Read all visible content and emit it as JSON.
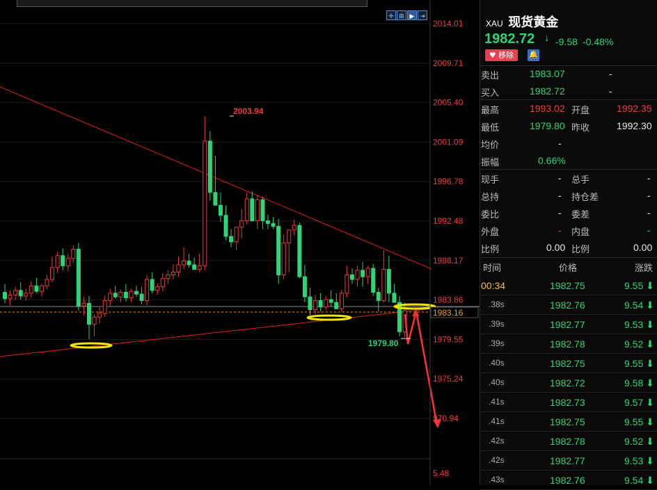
{
  "colors": {
    "up": "#ee3b3b",
    "down": "#2fd477",
    "accent_yellow": "#f2e400",
    "background": "#000000"
  },
  "toolbar": {
    "icons": [
      "crosshair-icon",
      "grid-icon",
      "play-icon",
      "export-icon"
    ]
  },
  "chart_data": {
    "type": "candlestick",
    "y_axis_labels": [
      "2014.01",
      "2009.71",
      "2005.40",
      "2001.09",
      "1996.78",
      "1992.48",
      "1988.17",
      "1983.86",
      "1979.55",
      "1975.24",
      "970.94"
    ],
    "volume_axis_label": "5.48",
    "current_price_label": "1983.16",
    "high_annotation": "2003.94",
    "low_annotation": "1979.80",
    "ylim": [
      1970.94,
      2014.01
    ],
    "candles": [
      [
        1984.7,
        1985.6,
        1983.5,
        1984.0
      ],
      [
        1984.0,
        1984.9,
        1983.3,
        1984.4
      ],
      [
        1984.4,
        1985.3,
        1983.9,
        1984.9
      ],
      [
        1984.9,
        1985.8,
        1983.9,
        1984.3
      ],
      [
        1984.3,
        1985.1,
        1983.8,
        1984.6
      ],
      [
        1984.6,
        1985.9,
        1984.1,
        1985.4
      ],
      [
        1985.4,
        1986.3,
        1984.6,
        1984.8
      ],
      [
        1984.8,
        1985.6,
        1984.2,
        1985.4
      ],
      [
        1985.4,
        1986.6,
        1985.0,
        1986.1
      ],
      [
        1986.1,
        1988.6,
        1985.8,
        1987.4
      ],
      [
        1987.4,
        1989.1,
        1986.8,
        1988.7
      ],
      [
        1988.7,
        1989.5,
        1987.1,
        1987.6
      ],
      [
        1987.6,
        1988.9,
        1987.0,
        1988.4
      ],
      [
        1988.4,
        1989.8,
        1987.9,
        1989.4
      ],
      [
        1989.4,
        1990.1,
        1982.7,
        1983.2
      ],
      [
        1983.2,
        1984.2,
        1982.2,
        1983.5
      ],
      [
        1983.5,
        1984.3,
        1979.6,
        1981.2
      ],
      [
        1981.2,
        1982.3,
        1979.9,
        1982.0
      ],
      [
        1982.0,
        1983.1,
        1981.3,
        1982.4
      ],
      [
        1982.4,
        1984.3,
        1982.0,
        1983.8
      ],
      [
        1983.8,
        1985.1,
        1983.2,
        1984.6
      ],
      [
        1984.6,
        1985.4,
        1984.0,
        1984.2
      ],
      [
        1984.2,
        1985.0,
        1983.6,
        1984.7
      ],
      [
        1984.7,
        1985.6,
        1983.7,
        1984.1
      ],
      [
        1984.1,
        1985.1,
        1983.6,
        1984.8
      ],
      [
        1984.8,
        1985.4,
        1984.2,
        1984.5
      ],
      [
        1984.5,
        1985.3,
        1983.4,
        1983.8
      ],
      [
        1983.8,
        1986.6,
        1983.3,
        1986.1
      ],
      [
        1986.1,
        1986.9,
        1984.6,
        1984.9
      ],
      [
        1984.9,
        1985.7,
        1984.4,
        1985.3
      ],
      [
        1985.3,
        1986.8,
        1984.8,
        1986.2
      ],
      [
        1986.2,
        1987.1,
        1985.6,
        1986.6
      ],
      [
        1986.6,
        1987.8,
        1986.1,
        1986.9
      ],
      [
        1986.9,
        1988.6,
        1986.4,
        1987.7
      ],
      [
        1987.7,
        1989.6,
        1987.2,
        1988.1
      ],
      [
        1988.1,
        1988.9,
        1987.4,
        1987.7
      ],
      [
        1987.7,
        1988.5,
        1987.1,
        1987.2
      ],
      [
        1987.2,
        1988.9,
        1986.9,
        1987.6
      ],
      [
        1987.6,
        2003.9,
        1987.1,
        2001.2
      ],
      [
        2001.2,
        2002.3,
        1994.7,
        1995.6
      ],
      [
        1995.6,
        1999.6,
        1994.2,
        1994.2
      ],
      [
        1994.2,
        1995.6,
        1992.4,
        1993.1
      ],
      [
        1993.1,
        1994.2,
        1990.4,
        1990.8
      ],
      [
        1990.8,
        1991.6,
        1989.6,
        1990.2
      ],
      [
        1990.2,
        1991.1,
        1989.3,
        1991.8
      ],
      [
        1991.8,
        1993.8,
        1990.6,
        1992.5
      ],
      [
        1992.5,
        1995.6,
        1992.1,
        1994.9
      ],
      [
        1994.9,
        1995.7,
        1992.4,
        1992.5
      ],
      [
        1992.5,
        1995.3,
        1991.6,
        1994.8
      ],
      [
        1994.8,
        1995.1,
        1991.6,
        1992.5
      ],
      [
        1992.5,
        1993.2,
        1991.6,
        1992.2
      ],
      [
        1992.2,
        1992.9,
        1991.6,
        1991.9
      ],
      [
        1991.9,
        1992.7,
        1985.6,
        1986.6
      ],
      [
        1986.6,
        1991.0,
        1986.1,
        1990.1
      ],
      [
        1990.1,
        1991.1,
        1986.9,
        1991.5
      ],
      [
        1991.5,
        1992.6,
        1990.9,
        1992.0
      ],
      [
        1992.0,
        1992.3,
        1986.2,
        1986.4
      ],
      [
        1986.4,
        1987.7,
        1983.6,
        1984.2
      ],
      [
        1984.2,
        1985.2,
        1982.2,
        1982.8
      ],
      [
        1982.8,
        1984.4,
        1982.3,
        1983.8
      ],
      [
        1983.8,
        1984.6,
        1982.6,
        1983.1
      ],
      [
        1983.1,
        1984.3,
        1982.7,
        1983.9
      ],
      [
        1983.9,
        1984.9,
        1983.1,
        1983.6
      ],
      [
        1983.6,
        1984.6,
        1982.9,
        1982.9
      ],
      [
        1982.9,
        1984.9,
        1982.6,
        1984.6
      ],
      [
        1984.6,
        1987.6,
        1984.1,
        1986.6
      ],
      [
        1986.6,
        1987.3,
        1985.6,
        1986.1
      ],
      [
        1986.1,
        1987.6,
        1985.3,
        1987.1
      ],
      [
        1987.1,
        1988.0,
        1985.3,
        1986.4
      ],
      [
        1986.4,
        1987.6,
        1985.6,
        1987.3
      ],
      [
        1987.3,
        1987.8,
        1984.3,
        1984.7
      ],
      [
        1984.7,
        1985.2,
        1982.6,
        1983.8
      ],
      [
        1983.8,
        1989.3,
        1983.6,
        1987.2
      ],
      [
        1987.2,
        1988.7,
        1983.6,
        1984.6
      ],
      [
        1984.6,
        1985.6,
        1983.6,
        1983.6
      ],
      [
        1983.6,
        1984.3,
        1979.9,
        1980.4
      ],
      [
        1980.4,
        1983.6,
        1979.8,
        1982.7
      ]
    ]
  },
  "panel": {
    "code": "XAU",
    "name": "现货黄金",
    "price": "1982.72",
    "arrow": "↓",
    "change": "-9.58",
    "change_pct": "-0.48%",
    "remove_label": "移除",
    "bell": "🔔",
    "quote": {
      "sell_label": "卖出",
      "sell_value": "1983.07",
      "sell_extra": "-",
      "buy_label": "买入",
      "buy_value": "1982.72",
      "buy_extra": "-",
      "high_label": "最高",
      "high_value": "1993.02",
      "open_label": "开盘",
      "open_value": "1992.35",
      "low_label": "最低",
      "low_value": "1979.80",
      "prev_label": "昨收",
      "prev_value": "1992.30",
      "avg_label": "均价",
      "avg_value": "-",
      "amp_label": "振幅",
      "amp_value": "0.66%",
      "cur_vol_label": "现手",
      "cur_vol_value": "-",
      "total_vol_label": "总手",
      "total_vol_value": "-",
      "total_oi_label": "总持",
      "total_oi_value": "-",
      "oi_diff_label": "持仓差",
      "oi_diff_value": "-",
      "ratio_label": "委比",
      "ratio_value": "-",
      "diff_label": "委差",
      "diff_value": "-",
      "outer_label": "外盘",
      "outer_value": "-",
      "inner_label": "内盘",
      "inner_value": "-",
      "pct1_label": "比例",
      "pct1_value": "0.00",
      "pct2_label": "比例",
      "pct2_value": "0.00"
    },
    "ticks": {
      "headers": [
        "时间",
        "价格",
        "涨跌"
      ],
      "rows": [
        {
          "time": "00:34",
          "price": "1982.75",
          "change": "9.55",
          "arrow": "⬇"
        },
        {
          "time": ".38s",
          "price": "1982.76",
          "change": "9.54",
          "arrow": "⬇"
        },
        {
          "time": ".39s",
          "price": "1982.77",
          "change": "9.53",
          "arrow": "⬇"
        },
        {
          "time": ".39s",
          "price": "1982.78",
          "change": "9.52",
          "arrow": "⬇"
        },
        {
          "time": ".40s",
          "price": "1982.75",
          "change": "9.55",
          "arrow": "⬇"
        },
        {
          "time": ".40s",
          "price": "1982.72",
          "change": "9.58",
          "arrow": "⬇"
        },
        {
          "time": ".41s",
          "price": "1982.73",
          "change": "9.57",
          "arrow": "⬇"
        },
        {
          "time": ".41s",
          "price": "1982.75",
          "change": "9.55",
          "arrow": "⬇"
        },
        {
          "time": ".42s",
          "price": "1982.78",
          "change": "9.52",
          "arrow": "⬇"
        },
        {
          "time": ".42s",
          "price": "1982.77",
          "change": "9.53",
          "arrow": "⬇"
        },
        {
          "time": ".43s",
          "price": "1982.76",
          "change": "9.54",
          "arrow": "⬇"
        }
      ]
    }
  }
}
